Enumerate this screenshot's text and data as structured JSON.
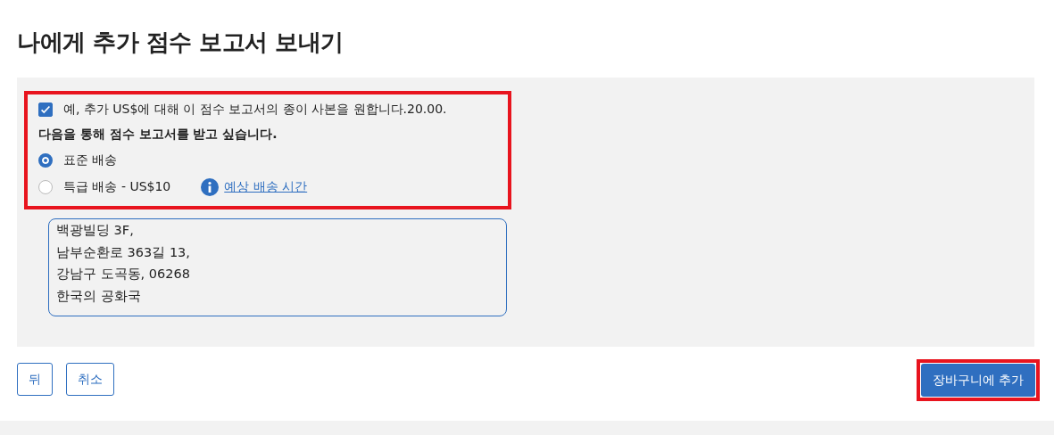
{
  "title": "나에게 추가 점수 보고서 보내기",
  "paper_copy": {
    "label": "예, 추가 US$에 대해 이 점수 보고서의 종이 사본을 원합니다.20.00.",
    "checked": true
  },
  "delivery_heading": "다음을 통해 점수 보고서를 받고 싶습니다.",
  "delivery_options": [
    {
      "label": "표준 배송",
      "selected": true
    },
    {
      "label": "특급 배송 - US$10",
      "selected": false,
      "link": "예상 배송 시간"
    }
  ],
  "address_lines": [
    "백광빌딩 3F,",
    "남부순환로 363길 13,",
    "강남구 도곡동, 06268",
    "한국의 공화국"
  ],
  "buttons": [
    {
      "label": "뒤",
      "kind": "outline"
    },
    {
      "label": "취소",
      "kind": "outline"
    },
    {
      "label": "장바구니에 추가",
      "kind": "primary"
    }
  ]
}
